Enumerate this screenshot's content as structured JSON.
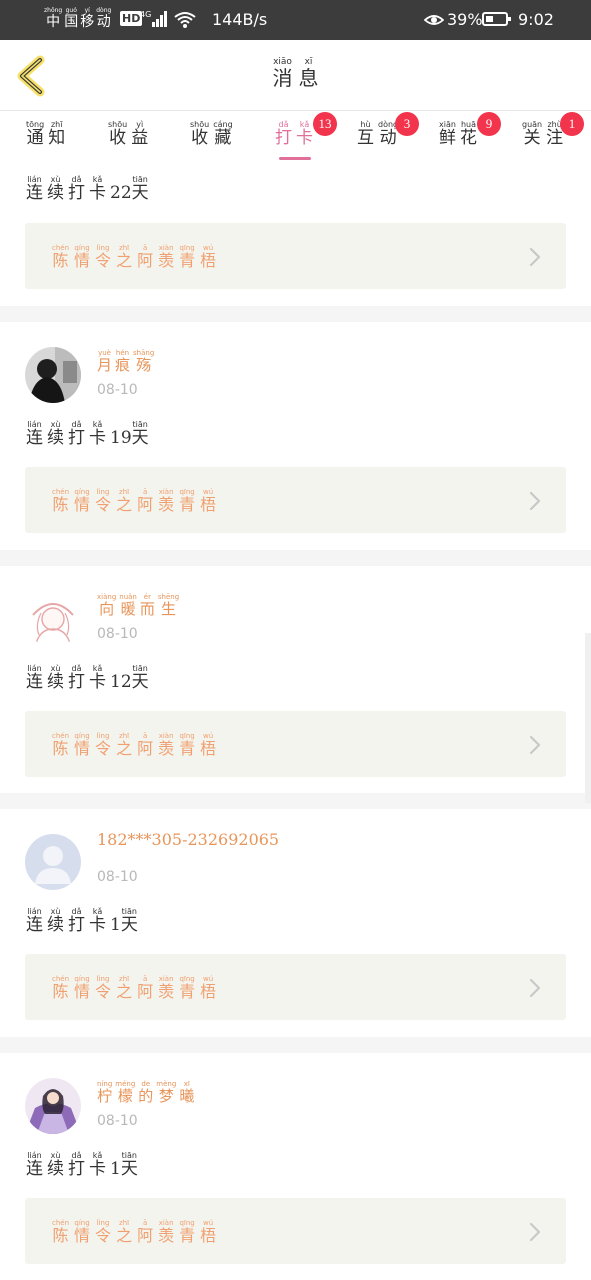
{
  "status_bar": {
    "carrier": [
      {
        "py": "zhōng",
        "hz": "中"
      },
      {
        "py": "guó",
        "hz": "国"
      },
      {
        "py": "yí",
        "hz": "移"
      },
      {
        "py": "dòng",
        "hz": "动"
      }
    ],
    "hd": "HD",
    "network": "4G",
    "speed": "144B/s",
    "battery_percent": "39%",
    "battery_level": 0.39,
    "time": "9:02"
  },
  "header": {
    "back_icon": "chevron-left-icon",
    "title": [
      {
        "py": "xiāo",
        "hz": "消"
      },
      {
        "py": "xī",
        "hz": "息"
      }
    ]
  },
  "tabs": [
    {
      "chars": [
        {
          "py": "tōng",
          "hz": "通"
        },
        {
          "py": "zhī",
          "hz": "知"
        }
      ],
      "badge": ""
    },
    {
      "chars": [
        {
          "py": "shōu",
          "hz": "收"
        },
        {
          "py": "yì",
          "hz": "益"
        }
      ],
      "badge": ""
    },
    {
      "chars": [
        {
          "py": "shōu",
          "hz": "收"
        },
        {
          "py": "cáng",
          "hz": "藏"
        }
      ],
      "badge": ""
    },
    {
      "chars": [
        {
          "py": "dǎ",
          "hz": "打"
        },
        {
          "py": "kǎ",
          "hz": "卡"
        }
      ],
      "badge": "13"
    },
    {
      "chars": [
        {
          "py": "hù",
          "hz": "互"
        },
        {
          "py": "dòng",
          "hz": "动"
        }
      ],
      "badge": "3"
    },
    {
      "chars": [
        {
          "py": "xiān",
          "hz": "鲜"
        },
        {
          "py": "huā",
          "hz": "花"
        }
      ],
      "badge": "9"
    },
    {
      "chars": [
        {
          "py": "guān",
          "hz": "关"
        },
        {
          "py": "zhù",
          "hz": "注"
        }
      ],
      "badge": "1"
    }
  ],
  "active_tab": 3,
  "colors": {
    "accent": "#e0709a",
    "badge": "#f2344c",
    "username": "#e8955a",
    "card_title": "#f0a070",
    "card_bg": "#f4f4ee"
  },
  "streak_words": [
    {
      "py": "lián",
      "hz": "连"
    },
    {
      "py": "xù",
      "hz": "续"
    },
    {
      "py": "dǎ",
      "hz": "打"
    },
    {
      "py": "kǎ",
      "hz": "卡"
    }
  ],
  "streak_unit": {
    "py": "tiān",
    "hz": "天"
  },
  "card_title": [
    {
      "py": "chén",
      "hz": "陈"
    },
    {
      "py": "qíng",
      "hz": "情"
    },
    {
      "py": "lìng",
      "hz": "令"
    },
    {
      "py": "zhī",
      "hz": "之"
    },
    {
      "py": "ā",
      "hz": "阿"
    },
    {
      "py": "xiàn",
      "hz": "羡"
    },
    {
      "py": "qīng",
      "hz": "青"
    },
    {
      "py": "wú",
      "hz": "梧"
    }
  ],
  "feed": [
    {
      "username": [],
      "date": "",
      "streak_days": "22",
      "avatar": "none"
    },
    {
      "username": [
        {
          "py": "yuè",
          "hz": "月"
        },
        {
          "py": "hén",
          "hz": "痕"
        },
        {
          "py": "shāng",
          "hz": "殇"
        }
      ],
      "username_plain": "",
      "date": "08-10",
      "streak_days": "19",
      "avatar": "photo-dark-avatar"
    },
    {
      "username": [
        {
          "py": "xiàng",
          "hz": "向"
        },
        {
          "py": "nuǎn",
          "hz": "暖"
        },
        {
          "py": "ér",
          "hz": "而"
        },
        {
          "py": "shēng",
          "hz": "生"
        }
      ],
      "username_plain": "",
      "date": "08-10",
      "streak_days": "12",
      "avatar": "sketch-avatar"
    },
    {
      "username": [],
      "username_plain": "182***305-232692065",
      "date": "08-10",
      "streak_days": "1",
      "avatar": "default-person-avatar"
    },
    {
      "username": [
        {
          "py": "níng",
          "hz": "柠"
        },
        {
          "py": "méng",
          "hz": "檬"
        },
        {
          "py": "de",
          "hz": "的"
        },
        {
          "py": "mèng",
          "hz": "梦"
        },
        {
          "py": "xī",
          "hz": "曦"
        }
      ],
      "username_plain": "",
      "date": "08-10",
      "streak_days": "1",
      "avatar": "costume-avatar"
    }
  ]
}
